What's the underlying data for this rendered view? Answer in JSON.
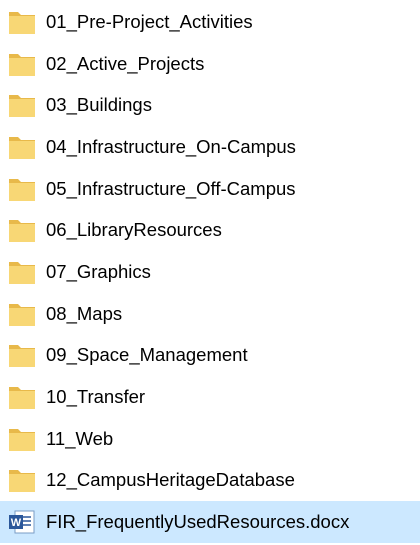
{
  "folders": [
    {
      "name": "01_Pre-Project_Activities",
      "type": "folder"
    },
    {
      "name": "02_Active_Projects",
      "type": "folder"
    },
    {
      "name": "03_Buildings",
      "type": "folder"
    },
    {
      "name": "04_Infrastructure_On-Campus",
      "type": "folder"
    },
    {
      "name": "05_Infrastructure_Off-Campus",
      "type": "folder"
    },
    {
      "name": "06_LibraryResources",
      "type": "folder"
    },
    {
      "name": "07_Graphics",
      "type": "folder"
    },
    {
      "name": "08_Maps",
      "type": "folder"
    },
    {
      "name": "09_Space_Management",
      "type": "folder"
    },
    {
      "name": "10_Transfer",
      "type": "folder"
    },
    {
      "name": "11_Web",
      "type": "folder"
    },
    {
      "name": "12_CampusHeritageDatabase",
      "type": "folder"
    }
  ],
  "file": {
    "name": "FIR_FrequentlyUsedResources.docx",
    "type": "word-document",
    "selected": true
  },
  "colors": {
    "folder_body": "#f8d775",
    "folder_back": "#e8b94a",
    "selection": "#cce8ff",
    "word_blue": "#2b579a"
  },
  "icons": {
    "folder": "folder-icon",
    "document": "word-document-icon"
  }
}
